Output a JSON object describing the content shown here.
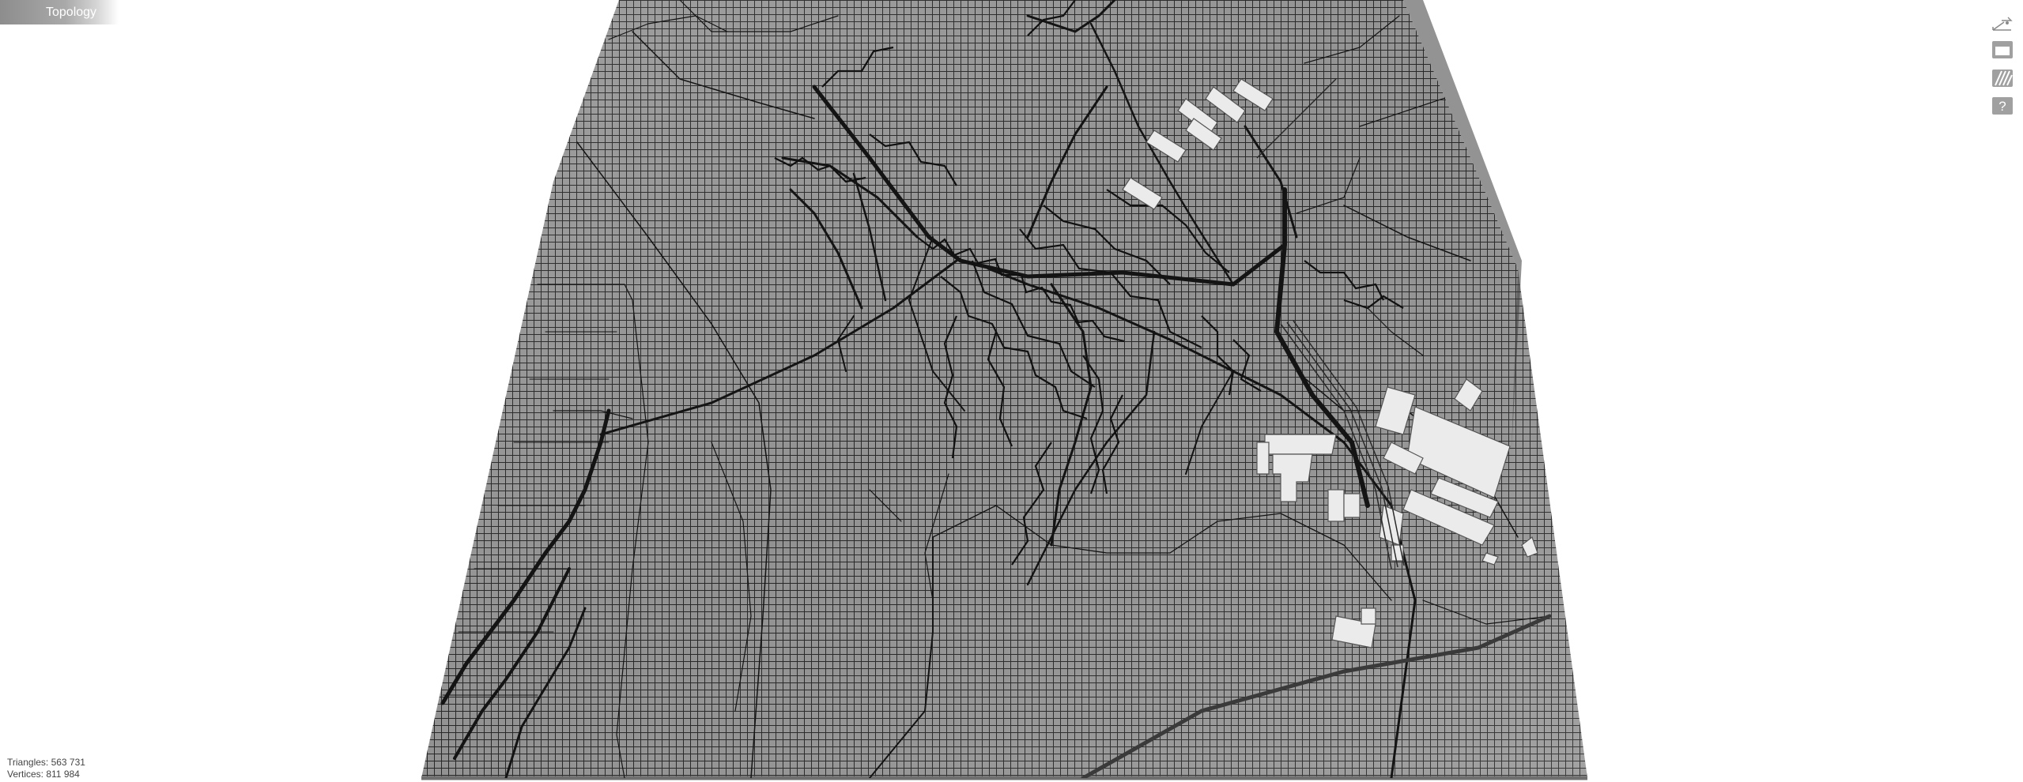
{
  "app": {
    "title": "Topology"
  },
  "toolbar": {
    "buttons": [
      {
        "name": "view-orientation-button",
        "icon": "axis-gizmo-icon"
      },
      {
        "name": "display-mode-button",
        "icon": "window-icon"
      },
      {
        "name": "texture-mode-button",
        "icon": "hatch-icon"
      },
      {
        "name": "help-button",
        "icon": "question-icon"
      }
    ]
  },
  "stats": {
    "triangles": "Triangles: 563 731",
    "vertices": "Vertices: 811 984"
  },
  "colors": {
    "background": "#ffffff",
    "terrain": "#8c8c8c",
    "wire": "#1f1f1f",
    "buildings": "#e9e9e9",
    "toolbar_icon": "#9a9a9a"
  }
}
